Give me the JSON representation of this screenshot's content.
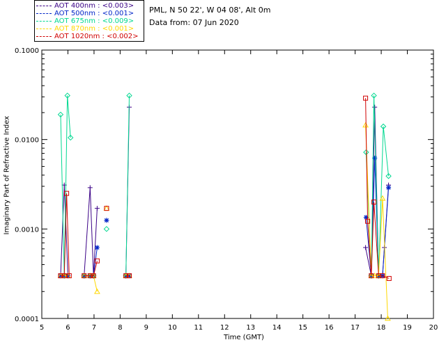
{
  "legend": [
    {
      "label": "AOT  400nm : <0.003>",
      "color": "#3a0086"
    },
    {
      "label": "AOT  500nm : <0.001>",
      "color": "#0024c8"
    },
    {
      "label": "AOT  675nm : <0.009>",
      "color": "#00d890"
    },
    {
      "label": "AOT  870nm : <0.001>",
      "color": "#ffd800"
    },
    {
      "label": "AOT 1020nm : <0.002>",
      "color": "#d00000"
    }
  ],
  "site": "PML, N 50 22', W 04 08', Alt 0m",
  "date": "Data from: 07 Jun 2020",
  "chart_data": {
    "type": "scatter",
    "title": "",
    "xlabel": "Time (GMT)",
    "ylabel": "Imaginary Part of Refractive Index",
    "xlim": [
      5,
      20
    ],
    "ylim": [
      0.0001,
      0.1
    ],
    "yscale": "log",
    "x_ticks": [
      "5",
      "6",
      "7",
      "8",
      "9",
      "10",
      "11",
      "12",
      "13",
      "14",
      "15",
      "16",
      "17",
      "18",
      "19",
      "20"
    ],
    "y_ticks": [
      "0.0001",
      "0.0010",
      "0.0100",
      "0.1000"
    ],
    "series": [
      {
        "name": "AOT  400nm",
        "color": "#3a0086",
        "marker": "plus",
        "points": [
          [
            5.72,
            0.0003
          ],
          [
            5.86,
            0.0031
          ],
          [
            6.0,
            0.0003
          ],
          [
            6.62,
            0.0003
          ],
          [
            6.85,
            0.0029
          ],
          [
            6.98,
            0.0003
          ],
          [
            7.12,
            0.0017
          ],
          [
            8.22,
            0.0003
          ],
          [
            8.35,
            0.023
          ],
          [
            17.4,
            0.00062
          ],
          [
            17.62,
            0.0003
          ],
          [
            17.75,
            0.023
          ],
          [
            17.9,
            0.0003
          ],
          [
            18.05,
            0.0003
          ],
          [
            18.12,
            0.00062
          ],
          [
            18.28,
            0.0031
          ]
        ]
      },
      {
        "name": "AOT  500nm",
        "color": "#0024c8",
        "marker": "star",
        "points": [
          [
            5.72,
            0.0003
          ],
          [
            5.86,
            0.0003
          ],
          [
            6.0,
            0.0003
          ],
          [
            6.62,
            0.0003
          ],
          [
            6.85,
            0.0003
          ],
          [
            6.98,
            0.0003
          ],
          [
            7.12,
            0.00062
          ],
          [
            7.48,
            0.00125
          ],
          [
            8.22,
            0.0003
          ],
          [
            8.35,
            0.0003
          ],
          [
            17.42,
            0.00135
          ],
          [
            17.62,
            0.0003
          ],
          [
            17.75,
            0.0062
          ],
          [
            17.9,
            0.0003
          ],
          [
            18.05,
            0.0003
          ],
          [
            18.28,
            0.0029
          ]
        ]
      },
      {
        "name": "AOT  675nm",
        "color": "#00d890",
        "marker": "diamond",
        "points": [
          [
            5.72,
            0.019
          ],
          [
            5.86,
            0.0003
          ],
          [
            5.98,
            0.031
          ],
          [
            6.1,
            0.0105
          ],
          [
            6.62,
            0.0003
          ],
          [
            6.85,
            0.0003
          ],
          [
            6.98,
            0.0003
          ],
          [
            7.48,
            0.001
          ],
          [
            8.22,
            0.0003
          ],
          [
            8.35,
            0.031
          ],
          [
            17.42,
            0.0072
          ],
          [
            17.62,
            0.0003
          ],
          [
            17.72,
            0.031
          ],
          [
            17.9,
            0.0003
          ],
          [
            18.08,
            0.014
          ],
          [
            18.28,
            0.0039
          ]
        ]
      },
      {
        "name": "AOT  870nm",
        "color": "#ffd800",
        "marker": "triangle",
        "points": [
          [
            5.72,
            0.0003
          ],
          [
            5.86,
            0.0003
          ],
          [
            6.0,
            0.0003
          ],
          [
            6.62,
            0.0003
          ],
          [
            6.85,
            0.0003
          ],
          [
            6.98,
            0.0003
          ],
          [
            7.12,
            0.0002
          ],
          [
            7.48,
            0.0017
          ],
          [
            8.22,
            0.0003
          ],
          [
            8.35,
            0.0003
          ],
          [
            17.4,
            0.0145
          ],
          [
            17.62,
            0.0003
          ],
          [
            17.75,
            0.0003
          ],
          [
            17.9,
            0.0003
          ],
          [
            18.05,
            0.0022
          ],
          [
            18.25,
            0.0001
          ]
        ]
      },
      {
        "name": "AOT 1020nm",
        "color": "#d00000",
        "marker": "square",
        "points": [
          [
            5.72,
            0.0003
          ],
          [
            5.86,
            0.0003
          ],
          [
            5.95,
            0.0025
          ],
          [
            6.05,
            0.0003
          ],
          [
            6.62,
            0.0003
          ],
          [
            6.85,
            0.0003
          ],
          [
            6.98,
            0.0003
          ],
          [
            7.12,
            0.00044
          ],
          [
            7.48,
            0.0017
          ],
          [
            8.22,
            0.0003
          ],
          [
            8.35,
            0.0003
          ],
          [
            17.4,
            0.029
          ],
          [
            17.48,
            0.00122
          ],
          [
            17.62,
            0.0003
          ],
          [
            17.72,
            0.002
          ],
          [
            17.9,
            0.0003
          ],
          [
            18.05,
            0.0003
          ],
          [
            18.3,
            0.00028
          ]
        ]
      }
    ]
  }
}
